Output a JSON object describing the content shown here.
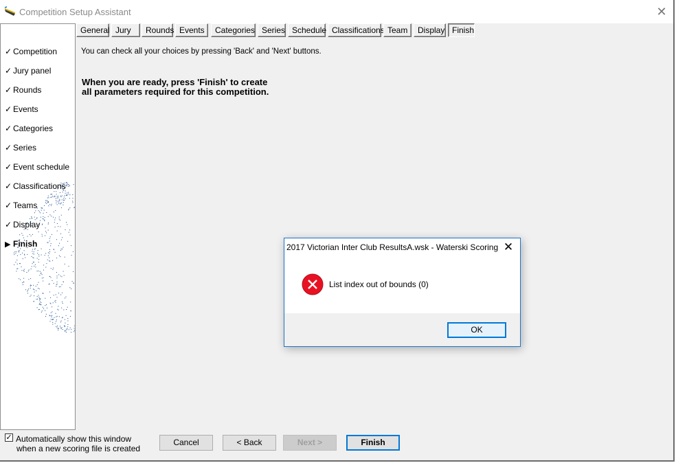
{
  "window": {
    "title": "Competition Setup Assistant",
    "app_icon": "ski-jump-icon",
    "close_glyph": "✕"
  },
  "sidebar": {
    "steps": [
      {
        "label": "Competition",
        "mark": "✓"
      },
      {
        "label": "Jury panel",
        "mark": "✓"
      },
      {
        "label": "Rounds",
        "mark": "✓"
      },
      {
        "label": "Events",
        "mark": "✓"
      },
      {
        "label": "Categories",
        "mark": "✓"
      },
      {
        "label": "Series",
        "mark": "✓"
      },
      {
        "label": "Event schedule",
        "mark": "✓"
      },
      {
        "label": "Classifications",
        "mark": "✓"
      },
      {
        "label": "Teams",
        "mark": "✓"
      },
      {
        "label": "Display",
        "mark": "✓"
      },
      {
        "label": "Finish",
        "mark": "▶"
      }
    ]
  },
  "tabs": [
    {
      "label": "General"
    },
    {
      "label": "Jury"
    },
    {
      "label": "Rounds"
    },
    {
      "label": "Events"
    },
    {
      "label": "Categories"
    },
    {
      "label": "Series"
    },
    {
      "label": "Schedule"
    },
    {
      "label": "Classifications"
    },
    {
      "label": "Team"
    },
    {
      "label": "Display"
    },
    {
      "label": "Finish"
    }
  ],
  "active_tab": "Finish",
  "content": {
    "info": "You can check all your choices by pressing 'Back' and 'Next' buttons.",
    "ready_line1": "When you are ready, press 'Finish' to create",
    "ready_line2": "all parameters required for this competition."
  },
  "footer": {
    "auto_show_checked": true,
    "auto_show_line1": "Automatically show this window",
    "auto_show_line2": "when a new scoring file is created",
    "cancel_label": "Cancel",
    "back_label": "< Back",
    "next_label": "Next >",
    "finish_label": "Finish"
  },
  "dialog": {
    "title": "2017 Victorian Inter Club ResultsA.wsk - Waterski Scoring",
    "message": "List index out of bounds (0)",
    "ok_label": "OK",
    "icon": "error-icon",
    "close_glyph": "✕"
  },
  "colors": {
    "accent": "#0078d7",
    "error": "#e81123",
    "window_bg": "#f0f0f0",
    "dots": "#1f4f8f"
  }
}
